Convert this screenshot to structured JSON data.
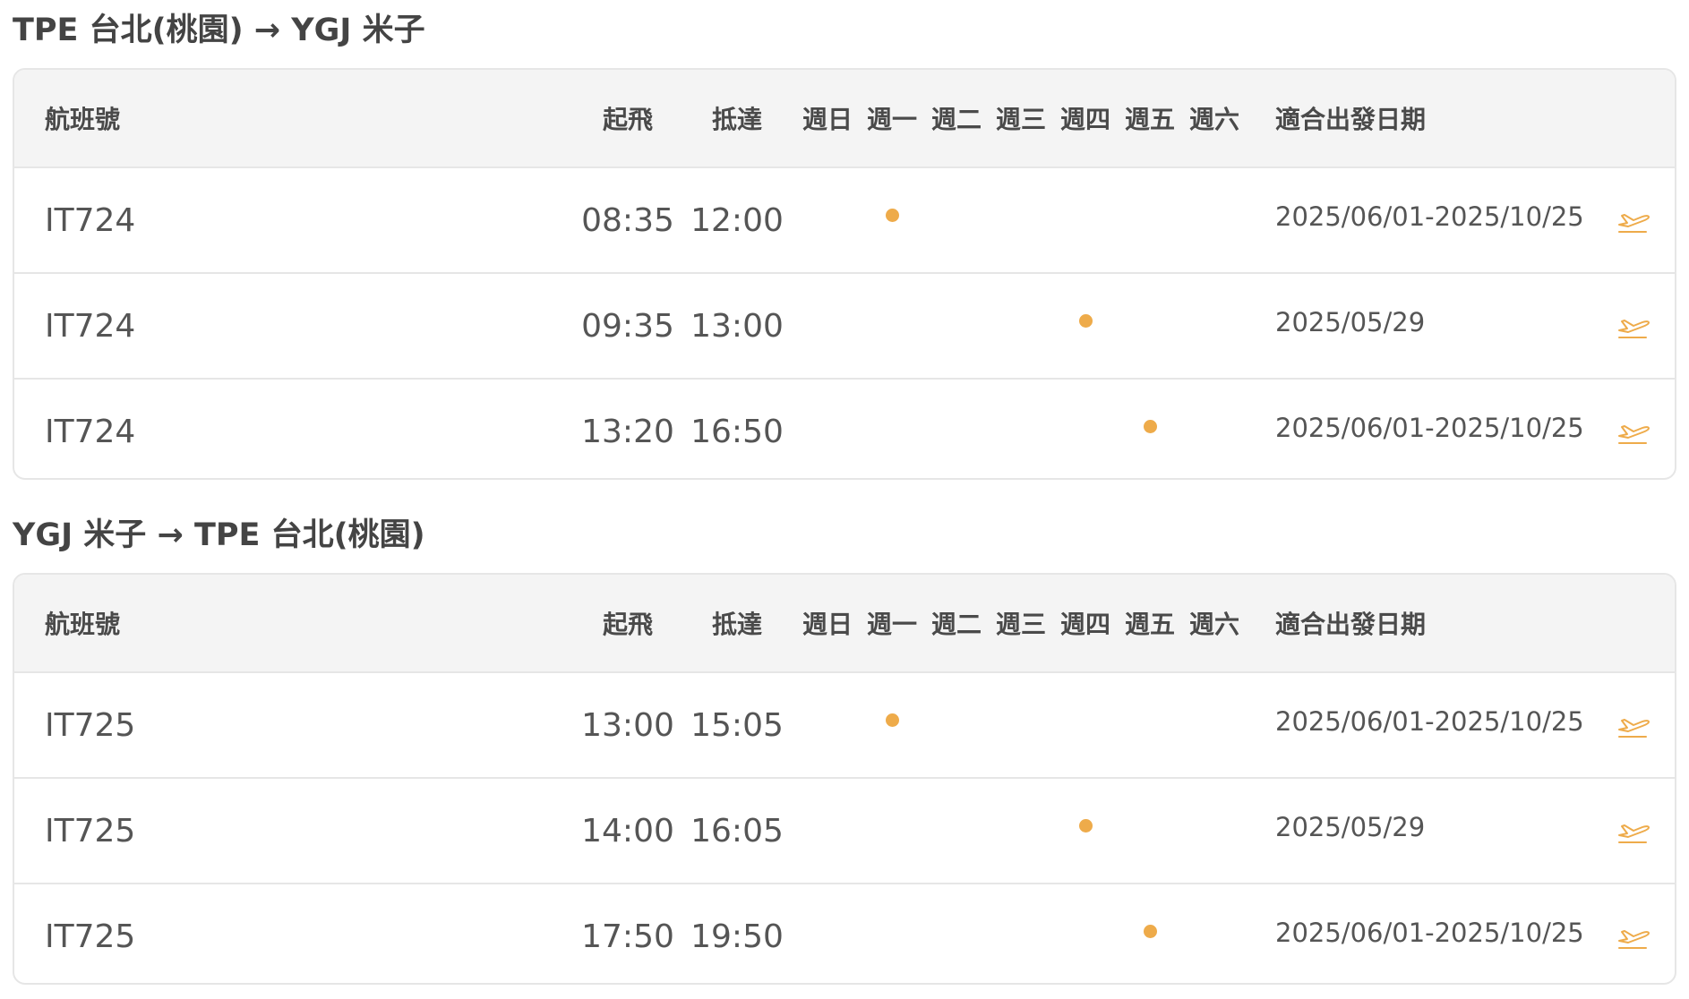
{
  "sections": [
    {
      "title": "TPE 台北(桃園) → YGJ 米子",
      "header": {
        "flight": "航班號",
        "departure": "起飛",
        "arrival": "抵達",
        "days": [
          "週日",
          "週一",
          "週二",
          "週三",
          "週四",
          "週五",
          "週六"
        ],
        "dates": "適合出發日期"
      },
      "rows": [
        {
          "flight": "IT724",
          "dep": "08:35",
          "arr": "12:00",
          "day_index": 1,
          "dates": "2025/06/01-2025/10/25",
          "action_icon": "plane-takeoff-icon"
        },
        {
          "flight": "IT724",
          "dep": "09:35",
          "arr": "13:00",
          "day_index": 4,
          "dates": "2025/05/29",
          "action_icon": "plane-takeoff-icon"
        },
        {
          "flight": "IT724",
          "dep": "13:20",
          "arr": "16:50",
          "day_index": 5,
          "dates": "2025/06/01-2025/10/25",
          "action_icon": "plane-takeoff-icon"
        }
      ]
    },
    {
      "title": "YGJ 米子 → TPE 台北(桃園)",
      "header": {
        "flight": "航班號",
        "departure": "起飛",
        "arrival": "抵達",
        "days": [
          "週日",
          "週一",
          "週二",
          "週三",
          "週四",
          "週五",
          "週六"
        ],
        "dates": "適合出發日期"
      },
      "rows": [
        {
          "flight": "IT725",
          "dep": "13:00",
          "arr": "15:05",
          "day_index": 1,
          "dates": "2025/06/01-2025/10/25",
          "action_icon": "plane-takeoff-icon"
        },
        {
          "flight": "IT725",
          "dep": "14:00",
          "arr": "16:05",
          "day_index": 4,
          "dates": "2025/05/29",
          "action_icon": "plane-takeoff-icon"
        },
        {
          "flight": "IT725",
          "dep": "17:50",
          "arr": "19:50",
          "day_index": 5,
          "dates": "2025/06/01-2025/10/25",
          "action_icon": "plane-takeoff-icon"
        }
      ]
    }
  ],
  "colors": {
    "accent": "#eeab4a",
    "header_bg": "#f4f4f4",
    "border": "#e6e6e6",
    "text": "#444444"
  }
}
